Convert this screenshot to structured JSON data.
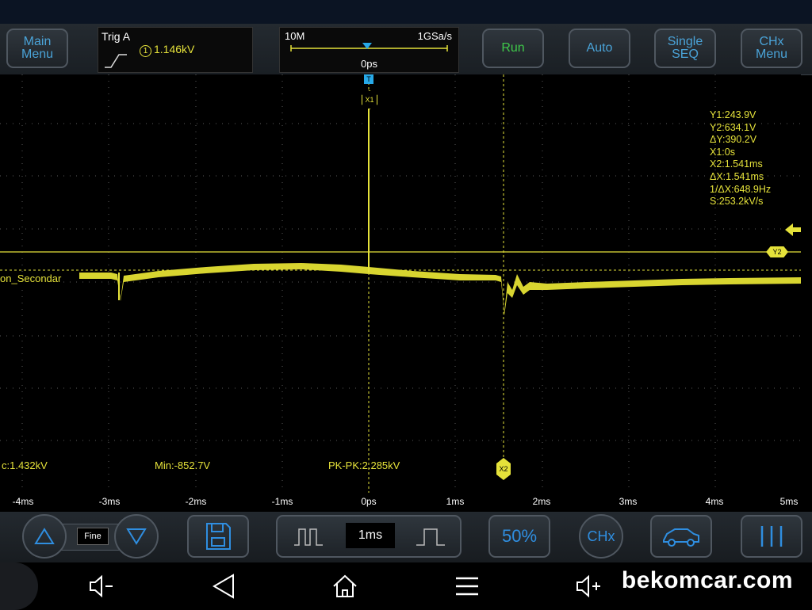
{
  "toolbar": {
    "main_menu": [
      "Main",
      "Menu"
    ],
    "trigger": {
      "title": "Trig A",
      "channel": "1",
      "level": "1.146kV"
    },
    "timebase": {
      "memory": "10M",
      "sample_rate": "1GSa/s",
      "position": "0ps"
    },
    "run": "Run",
    "auto": "Auto",
    "single_seq": [
      "Single",
      "SEQ"
    ],
    "chx_menu": [
      "CHx",
      "Menu"
    ]
  },
  "screen": {
    "channel_label": "on_Secondar",
    "markers": {
      "x1": "X1",
      "x2": "X2",
      "y2": "Y2",
      "t": "T"
    },
    "cursor_readout": [
      "Y1:243.9V",
      "Y2:634.1V",
      "ΔY:390.2V",
      "X1:0s",
      "X2:1.541ms",
      "ΔX:1.541ms",
      "1/ΔX:648.9Hz",
      "S:253.2kV/s"
    ],
    "measurements": {
      "max": "c:1.432kV",
      "min": "Min:-852.7V",
      "pkpk": "PK-PK:2.285kV"
    },
    "x_ticks": [
      "-4ms",
      "-3ms",
      "-2ms",
      "-1ms",
      "0ps",
      "1ms",
      "2ms",
      "3ms",
      "4ms",
      "5ms"
    ]
  },
  "bottombar": {
    "fine": "Fine",
    "timebase_value": "1ms",
    "fifty_percent": "50%",
    "chx": "CHx"
  },
  "watermark": "bekomcar.com",
  "colors": {
    "trace": "#e5e23a",
    "accent": "#2f8ee0",
    "run": "#3fc94a"
  },
  "icons": [
    "up-triangle-icon",
    "down-triangle-icon",
    "save-icon",
    "pulse-narrow-icon",
    "pulse-wide-icon",
    "car-icon",
    "columns-icon",
    "volume-down-icon",
    "back-icon",
    "home-icon",
    "menu-icon",
    "volume-up-icon"
  ]
}
